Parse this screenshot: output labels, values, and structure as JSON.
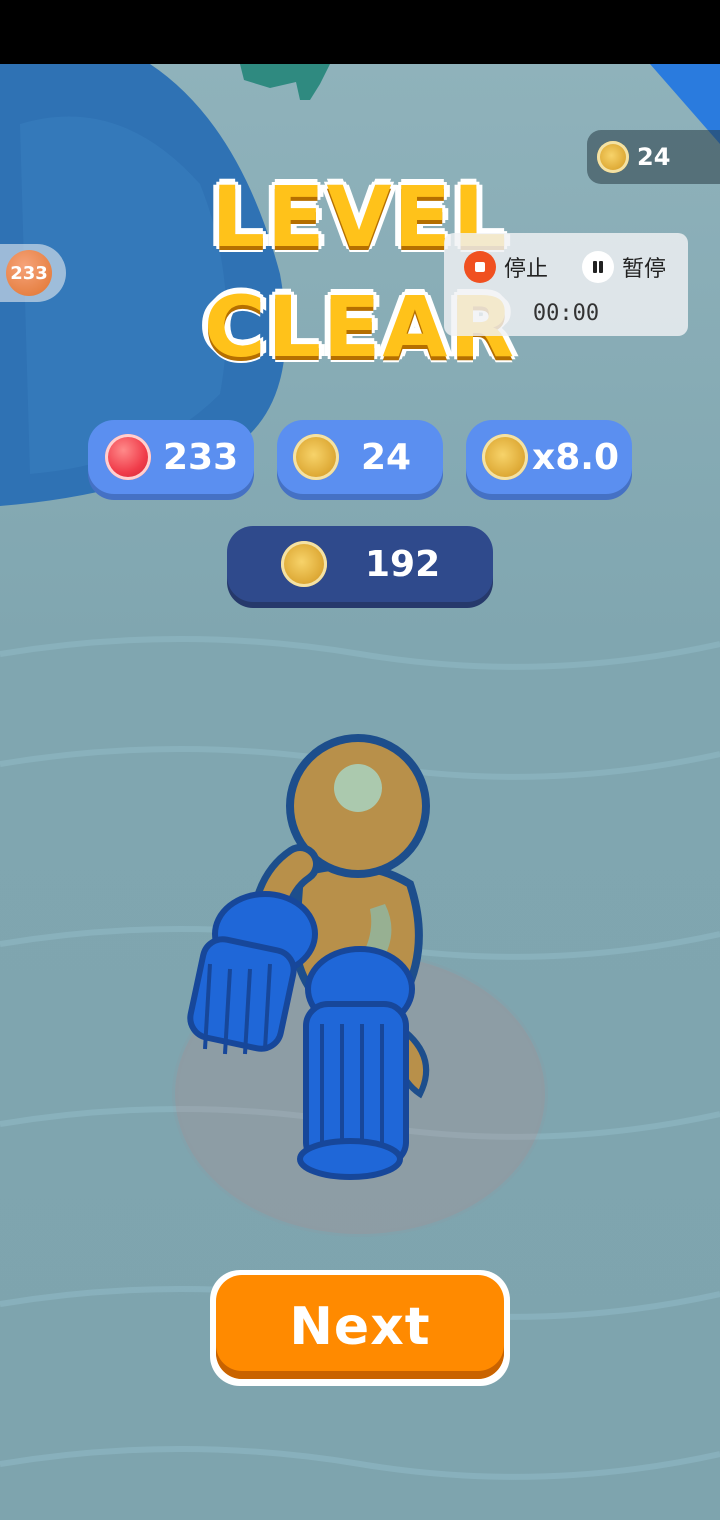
{
  "status_bar": {},
  "hud": {
    "coin_total": "24",
    "gem_side_count": "233"
  },
  "title": {
    "line1": "LEVEL",
    "line2": "CLEAR"
  },
  "recorder": {
    "stop_label": "停止",
    "pause_label": "暂停",
    "timer": "00:00"
  },
  "rewards": {
    "gems": "233",
    "coins": "24",
    "multiplier": "x8.0",
    "total": "192"
  },
  "next_button": {
    "label": "Next"
  },
  "colors": {
    "pill_blue": "#5b8ff0",
    "pill_dark": "#2f4a8c",
    "next_orange": "#ff8a00",
    "title_yellow": "#ffc21a",
    "floor": "#7fa3ad",
    "character_skin": "#b8904a",
    "character_blue": "#1f67d8"
  },
  "icons": {
    "coin": "coin-icon",
    "gem": "gem-icon",
    "stop": "stop-icon",
    "pause": "pause-icon"
  }
}
